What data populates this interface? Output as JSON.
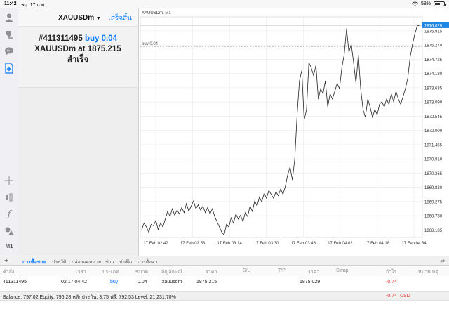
{
  "status_bar": {
    "time": "11:42",
    "date": "พฤ. 17 ก.พ.",
    "battery": "58%",
    "battery_level": 0.58,
    "icons": [
      "wifi-icon",
      "battery-icon"
    ]
  },
  "left_toolbar": {
    "tools": [
      "person-icon",
      "quotes-icon",
      "chat-icon",
      "new-order-icon",
      "crosshair-icon",
      "objects-icon",
      "indicator-f-icon",
      "shapes-icon"
    ],
    "timeframe": "M1"
  },
  "panel": {
    "symbol": "XAUUSDm",
    "done_label": "เสร็จสิ้น",
    "order_number": "#411311495",
    "order_side": "buy 0.04",
    "order_line": "XAUUSDm at",
    "order_price": "1875.215",
    "order_status": "สำเร็จ"
  },
  "chart": {
    "title": "XAUUSDm, M1",
    "position_label": "buy 0.04",
    "current_price": "1876.029",
    "colors": {
      "line": "#222222",
      "grid": "#e6e6e6",
      "price_tag": "#1e88e5",
      "position_line": "#9e9e9e"
    },
    "y_ticks": [
      "1875.815",
      "1875.270",
      "1874.725",
      "1874.180",
      "1873.635",
      "1873.090",
      "1872.545",
      "1872.000",
      "1871.455",
      "1870.910",
      "1870.365",
      "1869.820",
      "1869.275",
      "1868.730",
      "1868.185"
    ],
    "x_ticks": [
      "17 Feb 02:42",
      "17 Feb 02:58",
      "17 Feb 03:14",
      "17 Feb 03:30",
      "17 Feb 03:46",
      "17 Feb 04:02",
      "17 Feb 04:18",
      "17 Feb 04:34"
    ]
  },
  "chart_data": {
    "type": "line",
    "title": "XAUUSDm, M1",
    "xlabel": "",
    "ylabel": "",
    "ylim": [
      1867.9,
      1876.35
    ],
    "grid": true,
    "series": [
      {
        "values": [
          1868.2,
          1868.45,
          1868.3,
          1868.1,
          1868.4,
          1868.35,
          1868.55,
          1868.2,
          1868.45,
          1868.3,
          1868.6,
          1868.9,
          1868.7,
          1869.0,
          1868.75,
          1868.95,
          1868.8,
          1869.05,
          1868.85,
          1869.2,
          1868.9,
          1869.1,
          1869.3,
          1869.0,
          1869.15,
          1868.95,
          1869.1,
          1868.85,
          1869.05,
          1868.8,
          1869.0,
          1868.7,
          1868.5,
          1868.3,
          1868.1,
          1868.0,
          1868.4,
          1868.3,
          1868.65,
          1868.45,
          1868.8,
          1868.6,
          1868.75,
          1868.5,
          1868.85,
          1868.7,
          1869.1,
          1868.9,
          1869.3,
          1869.1,
          1869.45,
          1869.25,
          1869.6,
          1869.4,
          1869.7,
          1869.55,
          1869.4,
          1869.65,
          1869.5,
          1869.75,
          1869.55,
          1869.85,
          1870.3,
          1870.6,
          1870.1,
          1870.9,
          1872.6,
          1873.9,
          1874.3,
          1872.4,
          1872.8,
          1874.6,
          1874.4,
          1874.1,
          1874.5,
          1873.2,
          1873.6,
          1873.4,
          1873.9,
          1872.9,
          1873.4,
          1873.2,
          1873.5,
          1873.8,
          1873.6,
          1874.4,
          1874.9,
          1875.9,
          1875.0,
          1875.3,
          1874.6,
          1873.8,
          1874.9,
          1873.6,
          1872.8,
          1872.5,
          1873.2,
          1872.9,
          1872.5,
          1872.8,
          1872.6,
          1873.0,
          1873.1,
          1872.9,
          1873.2,
          1873.0,
          1873.4,
          1873.1,
          1873.5,
          1873.2,
          1873.0,
          1873.3,
          1873.6,
          1874.0,
          1874.8,
          1875.3,
          1875.7,
          1876.0,
          1876.029
        ]
      }
    ],
    "x_ticks": [
      "17 Feb 02:42",
      "17 Feb 02:58",
      "17 Feb 03:14",
      "17 Feb 03:30",
      "17 Feb 03:46",
      "17 Feb 04:02",
      "17 Feb 04:18",
      "17 Feb 04:34"
    ],
    "y_ticks": [
      1875.815,
      1875.27,
      1874.725,
      1874.18,
      1873.635,
      1873.09,
      1872.545,
      1872.0,
      1871.455,
      1870.91,
      1870.365,
      1869.82,
      1869.275,
      1868.73,
      1868.185
    ],
    "annotations": [
      {
        "type": "hline",
        "label": "buy 0.04",
        "y": 1875.215
      },
      {
        "type": "price_tag",
        "label": "1876.029",
        "y": 1876.029
      }
    ]
  },
  "tabs": {
    "items": [
      "การซื้อขาย",
      "ประวัติ",
      "กล่องจดหมาย",
      "ข่าว",
      "บันทึก",
      "การตั้งค่า"
    ],
    "active": 0
  },
  "table": {
    "headers": [
      "คำสั่ง",
      "เวลา",
      "ประเภท",
      "ขนาด",
      "สัญลักษณ์",
      "ราคา",
      "S/L",
      "T/P",
      "ราคา",
      "Swap",
      "กำไร",
      "หมายเหตุ"
    ],
    "row": [
      "411311495",
      "02.17 04:42",
      "buy",
      "0.04",
      "xauusdm",
      "1875.215",
      "",
      "",
      "1875.029",
      "",
      "-0.74",
      ""
    ]
  },
  "balance": {
    "text": "Balance: 797.02 Equity: 796.28 หลักประกัน: 3.75 ฟรี: 792.53 Level: 21 231.70%",
    "total": "-0.74",
    "currency": "USD"
  }
}
